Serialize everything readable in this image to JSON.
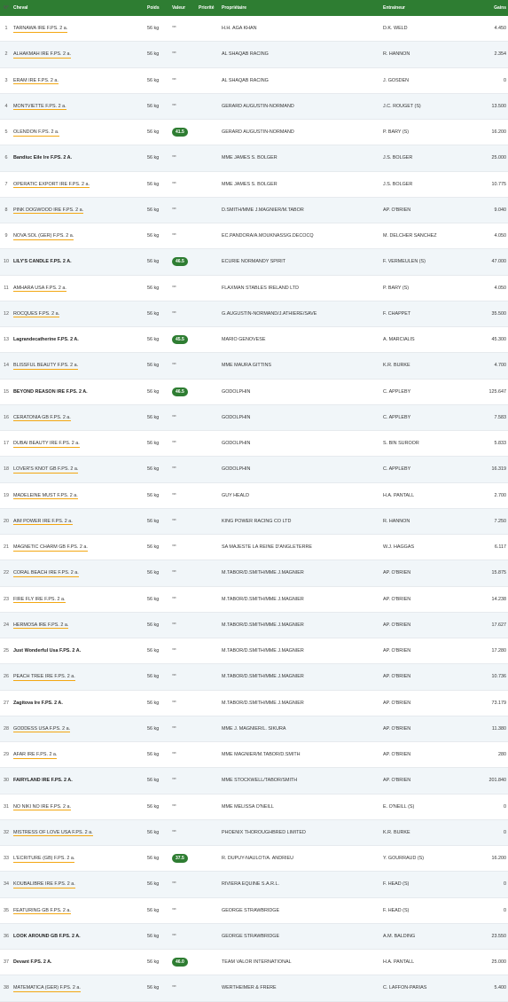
{
  "header": {
    "num": "N°",
    "horse": "Cheval",
    "weight": "Poids",
    "valeur": "Valeur",
    "priority": "Priorité",
    "owner": "Propriétaire",
    "trainer": "Entraineur",
    "gains": "Gains"
  },
  "colors": {
    "header_bg": "#2e7d32",
    "badge_bg": "#2e7d32",
    "link_underline": "#f3a712"
  },
  "rows": [
    {
      "num": "1",
      "horse": "TARNAWA IRE F.PS. 2 a.",
      "bold": false,
      "weight": "56 kg",
      "valeur": "***",
      "badge": false,
      "owner": "H.H. AGA KHAN",
      "trainer": "D.K. WELD",
      "gains": "4.450"
    },
    {
      "num": "2",
      "horse": "ALHAKMAH IRE F.PS. 2 a.",
      "bold": false,
      "weight": "56 kg",
      "valeur": "***",
      "badge": false,
      "owner": "AL SHAQAB RACING",
      "trainer": "R. HANNON",
      "gains": "2.354"
    },
    {
      "num": "3",
      "horse": "ERAM IRE F.PS. 2 a.",
      "bold": false,
      "weight": "56 kg",
      "valeur": "***",
      "badge": false,
      "owner": "AL SHAQAB RACING",
      "trainer": "J. GOSDEN",
      "gains": "0"
    },
    {
      "num": "4",
      "horse": "MONTVIETTE F.PS. 2 a.",
      "bold": false,
      "weight": "56 kg",
      "valeur": "***",
      "badge": false,
      "owner": "GERARD AUGUSTIN-NORMAND",
      "trainer": "J.C. ROUGET (S)",
      "gains": "13.500"
    },
    {
      "num": "5",
      "horse": "OLENDON F.PS. 2 a.",
      "bold": false,
      "weight": "56 kg",
      "valeur": "41.5",
      "badge": true,
      "owner": "GERARD AUGUSTIN-NORMAND",
      "trainer": "P. BARY (S)",
      "gains": "16.200"
    },
    {
      "num": "6",
      "horse": "Bandiuc Eile Ire F.PS. 2 A.",
      "bold": true,
      "weight": "56 kg",
      "valeur": "***",
      "badge": false,
      "owner": "MME JAMES S. BOLGER",
      "trainer": "J.S. BOLGER",
      "gains": "25.000"
    },
    {
      "num": "7",
      "horse": "OPERATIC EXPORT IRE F.PS. 2 a.",
      "bold": false,
      "weight": "56 kg",
      "valeur": "***",
      "badge": false,
      "owner": "MME JAMES S. BOLGER",
      "trainer": "J.S. BOLGER",
      "gains": "10.775"
    },
    {
      "num": "8",
      "horse": "PINK DOGWOOD IRE F.PS. 2 a.",
      "bold": false,
      "weight": "56 kg",
      "valeur": "***",
      "badge": false,
      "owner": "D.SMITH/MME J.MAGNIER/M.TABOR",
      "trainer": "AP. O'BRIEN",
      "gains": "9.040"
    },
    {
      "num": "9",
      "horse": "NOVA SOL (GER) F.PS. 2 a.",
      "bold": false,
      "weight": "56 kg",
      "valeur": "***",
      "badge": false,
      "owner": "EC.PANDORA/A.MOUKNASS/G.DECOCQ",
      "trainer": "M. DELCHER SANCHEZ",
      "gains": "4.050"
    },
    {
      "num": "10",
      "horse": "LILY'S CANDLE F.PS. 2 A.",
      "bold": true,
      "weight": "56 kg",
      "valeur": "46.5",
      "badge": true,
      "owner": "ECURIE NORMANDY SPIRIT",
      "trainer": "F. VERMEULEN (S)",
      "gains": "47.000"
    },
    {
      "num": "11",
      "horse": "AMHARA USA F.PS. 2 a.",
      "bold": false,
      "weight": "56 kg",
      "valeur": "***",
      "badge": false,
      "owner": "FLAXMAN STABLES IRELAND LTD",
      "trainer": "P. BARY (S)",
      "gains": "4.050"
    },
    {
      "num": "12",
      "horse": "ROCQUES F.PS. 2 a.",
      "bold": false,
      "weight": "56 kg",
      "valeur": "***",
      "badge": false,
      "owner": "G.AUGUSTIN-NORMAND/J.ATHIERE/SAVE",
      "trainer": "F. CHAPPET",
      "gains": "35.500"
    },
    {
      "num": "13",
      "horse": "Lagrandecatherine F.PS. 2 A.",
      "bold": true,
      "weight": "56 kg",
      "valeur": "45.5",
      "badge": true,
      "owner": "MARIO GENOVESE",
      "trainer": "A. MARCIALIS",
      "gains": "45.300"
    },
    {
      "num": "14",
      "horse": "BLISSFUL BEAUTY F.PS. 2 a.",
      "bold": false,
      "weight": "56 kg",
      "valeur": "***",
      "badge": false,
      "owner": "MME MAURA GITTINS",
      "trainer": "K.R. BURKE",
      "gains": "4.700"
    },
    {
      "num": "15",
      "horse": "BEYOND REASON IRE F.PS. 2 A.",
      "bold": true,
      "weight": "56 kg",
      "valeur": "46.5",
      "badge": true,
      "owner": "GODOLPHIN",
      "trainer": "C. APPLEBY",
      "gains": "125.647"
    },
    {
      "num": "16",
      "horse": "CERATONIA GB F.PS. 2 a.",
      "bold": false,
      "weight": "56 kg",
      "valeur": "***",
      "badge": false,
      "owner": "GODOLPHIN",
      "trainer": "C. APPLEBY",
      "gains": "7.583"
    },
    {
      "num": "17",
      "horse": "DUBAI BEAUTY IRE F.PS. 2 a.",
      "bold": false,
      "weight": "56 kg",
      "valeur": "***",
      "badge": false,
      "owner": "GODOLPHIN",
      "trainer": "S. BIN SUROOR",
      "gains": "5.833"
    },
    {
      "num": "18",
      "horse": "LOVER'S KNOT GB F.PS. 2 a.",
      "bold": false,
      "weight": "56 kg",
      "valeur": "***",
      "badge": false,
      "owner": "GODOLPHIN",
      "trainer": "C. APPLEBY",
      "gains": "16.319"
    },
    {
      "num": "19",
      "horse": "MADELEINE MUST F.PS. 2 a.",
      "bold": false,
      "weight": "56 kg",
      "valeur": "***",
      "badge": false,
      "owner": "GUY HEALD",
      "trainer": "H.A. PANTALL",
      "gains": "2.700"
    },
    {
      "num": "20",
      "horse": "AIM POWER IRE F.PS. 2 a.",
      "bold": false,
      "weight": "56 kg",
      "valeur": "***",
      "badge": false,
      "owner": "KING POWER RACING CO LTD",
      "trainer": "R. HANNON",
      "gains": "7.250"
    },
    {
      "num": "21",
      "horse": "MAGNETIC CHARM GB F.PS. 2 a.",
      "bold": false,
      "weight": "56 kg",
      "valeur": "***",
      "badge": false,
      "owner": "SA MAJESTE LA REINE D'ANGLETERRE",
      "trainer": "W.J. HAGGAS",
      "gains": "6.117"
    },
    {
      "num": "22",
      "horse": "CORAL BEACH IRE F.PS. 2 a.",
      "bold": false,
      "weight": "56 kg",
      "valeur": "***",
      "badge": false,
      "owner": "M.TABOR/D.SMITH/MME J.MAGNIER",
      "trainer": "AP. O'BRIEN",
      "gains": "15.875"
    },
    {
      "num": "23",
      "horse": "FIRE FLY IRE F.PS. 2 a.",
      "bold": false,
      "weight": "56 kg",
      "valeur": "***",
      "badge": false,
      "owner": "M.TABOR/D.SMITH/MME J.MAGNIER",
      "trainer": "AP. O'BRIEN",
      "gains": "14.238"
    },
    {
      "num": "24",
      "horse": "HERMOSA IRE F.PS. 2 a.",
      "bold": false,
      "weight": "56 kg",
      "valeur": "***",
      "badge": false,
      "owner": "M.TABOR/D.SMITH/MME J.MAGNIER",
      "trainer": "AP. O'BRIEN",
      "gains": "17.627"
    },
    {
      "num": "25",
      "horse": "Just Wonderful Usa F.PS. 2 A.",
      "bold": true,
      "weight": "56 kg",
      "valeur": "***",
      "badge": false,
      "owner": "M.TABOR/D.SMITH/MME J.MAGNIER",
      "trainer": "AP. O'BRIEN",
      "gains": "17.280"
    },
    {
      "num": "26",
      "horse": "PEACH TREE IRE F.PS. 2 a.",
      "bold": false,
      "weight": "56 kg",
      "valeur": "***",
      "badge": false,
      "owner": "M.TABOR/D.SMITH/MME J.MAGNIER",
      "trainer": "AP. O'BRIEN",
      "gains": "10.736"
    },
    {
      "num": "27",
      "horse": "Zagitova Ire F.PS. 2 A.",
      "bold": true,
      "weight": "56 kg",
      "valeur": "***",
      "badge": false,
      "owner": "M.TABOR/D.SMITH/MME J.MAGNIER",
      "trainer": "AP. O'BRIEN",
      "gains": "73.179"
    },
    {
      "num": "28",
      "horse": "GODDESS USA F.PS. 2 a.",
      "bold": false,
      "weight": "56 kg",
      "valeur": "***",
      "badge": false,
      "owner": "MME J. MAGNIER/L. SIKURA",
      "trainer": "AP. O'BRIEN",
      "gains": "11.380"
    },
    {
      "num": "29",
      "horse": "AFAR IRE F.PS. 2 a.",
      "bold": false,
      "weight": "56 kg",
      "valeur": "***",
      "badge": false,
      "owner": "MME MAGNIER/M.TABOR/D.SMITH",
      "trainer": "AP. O'BRIEN",
      "gains": "280"
    },
    {
      "num": "30",
      "horse": "FAIRYLAND IRE F.PS. 2 A.",
      "bold": true,
      "weight": "56 kg",
      "valeur": "***",
      "badge": false,
      "owner": "MME STOCKWELL/TABOR/SMITH",
      "trainer": "AP. O'BRIEN",
      "gains": "201.840"
    },
    {
      "num": "31",
      "horse": "NO NIKI NO IRE F.PS. 2 a.",
      "bold": false,
      "weight": "56 kg",
      "valeur": "***",
      "badge": false,
      "owner": "MME MELISSA O'NEILL",
      "trainer": "E. O'NEILL (S)",
      "gains": "0"
    },
    {
      "num": "32",
      "horse": "MISTRESS OF LOVE USA F.PS. 2 a.",
      "bold": false,
      "weight": "56 kg",
      "valeur": "***",
      "badge": false,
      "owner": "PHOENIX THOROUGHBRED LIMITED",
      "trainer": "K.R. BURKE",
      "gains": "0"
    },
    {
      "num": "33",
      "horse": "L'ECRITURE (GB) F.PS. 2 a.",
      "bold": false,
      "weight": "56 kg",
      "valeur": "37.5",
      "badge": true,
      "owner": "R. DUPUY-NAULOT/A. ANDRIEU",
      "trainer": "Y. GOURRAUD (S)",
      "gains": "16.200"
    },
    {
      "num": "34",
      "horse": "KOUBALIBRE IRE F.PS. 2 a.",
      "bold": false,
      "weight": "56 kg",
      "valeur": "***",
      "badge": false,
      "owner": "RIVIERA EQUINE S.A.R.L.",
      "trainer": "F. HEAD (S)",
      "gains": "0"
    },
    {
      "num": "35",
      "horse": "FEATURING GB F.PS. 2 a.",
      "bold": false,
      "weight": "56 kg",
      "valeur": "***",
      "badge": false,
      "owner": "GEORGE STRAWBRIDGE",
      "trainer": "F. HEAD (S)",
      "gains": "0"
    },
    {
      "num": "36",
      "horse": "LOOK AROUND GB F.PS. 2 A.",
      "bold": true,
      "weight": "56 kg",
      "valeur": "***",
      "badge": false,
      "owner": "GEORGE STRAWBRIDGE",
      "trainer": "A.M. BALDING",
      "gains": "23.550"
    },
    {
      "num": "37",
      "horse": "Devant F.PS. 2 A.",
      "bold": true,
      "weight": "56 kg",
      "valeur": "46.0",
      "badge": true,
      "owner": "TEAM VALOR INTERNATIONAL",
      "trainer": "H.A. PANTALL",
      "gains": "25.000"
    },
    {
      "num": "38",
      "horse": "MATEMATICA (GER) F.PS. 2 a.",
      "bold": false,
      "weight": "56 kg",
      "valeur": "***",
      "badge": false,
      "owner": "WERTHEIMER & FRERE",
      "trainer": "C. LAFFON-PARIAS",
      "gains": "5.400"
    }
  ]
}
